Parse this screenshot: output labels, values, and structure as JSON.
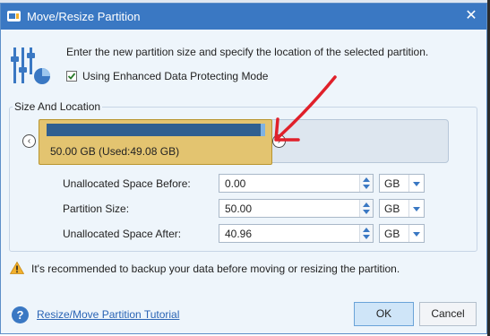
{
  "window": {
    "title": "Move/Resize Partition"
  },
  "intro_text": "Enter the new partition size and specify the location of the selected partition.",
  "option": {
    "label": "Using Enhanced Data Protecting Mode",
    "checked": true
  },
  "group": {
    "title": "Size And Location"
  },
  "partition": {
    "label": "50.00 GB (Used:49.08 GB)",
    "used_fraction": 0.98
  },
  "fields": [
    {
      "label": "Unallocated Space Before:",
      "value": "0.00",
      "unit": "GB"
    },
    {
      "label": "Partition Size:",
      "value": "50.00",
      "unit": "GB"
    },
    {
      "label": "Unallocated Space After:",
      "value": "40.96",
      "unit": "GB"
    }
  ],
  "warning": "It's recommended to backup your data before moving or resizing the partition.",
  "help": {
    "label": "Resize/Move Partition Tutorial"
  },
  "buttons": {
    "ok": "OK",
    "cancel": "Cancel"
  },
  "colors": {
    "title_bar": "#3a78c3",
    "partition": "#e3c470",
    "used_bar": "#2f5f90",
    "annotation_arrow": "#e0202a"
  }
}
